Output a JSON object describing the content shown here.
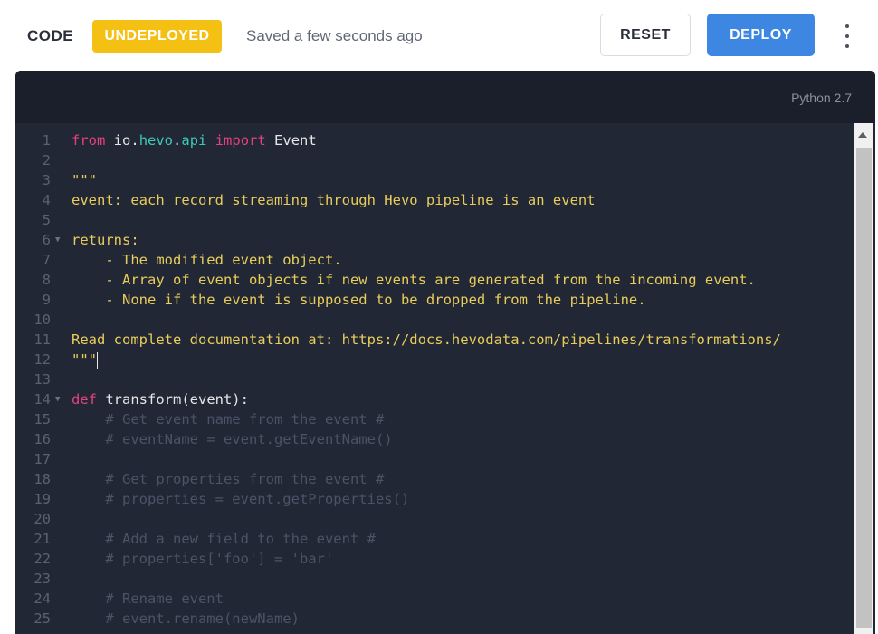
{
  "header": {
    "title": "CODE",
    "status_badge": "UNDEPLOYED",
    "saved_text": "Saved a few seconds ago",
    "reset_label": "RESET",
    "deploy_label": "DEPLOY",
    "more_icon": "kebab-menu-icon"
  },
  "editor": {
    "language": "Python 2.7",
    "lines": [
      {
        "n": "1"
      },
      {
        "n": "2"
      },
      {
        "n": "3"
      },
      {
        "n": "4"
      },
      {
        "n": "5"
      },
      {
        "n": "6"
      },
      {
        "n": "7"
      },
      {
        "n": "8"
      },
      {
        "n": "9"
      },
      {
        "n": "10"
      },
      {
        "n": "11"
      },
      {
        "n": "12"
      },
      {
        "n": "13"
      },
      {
        "n": "14"
      },
      {
        "n": "15"
      },
      {
        "n": "16"
      },
      {
        "n": "17"
      },
      {
        "n": "18"
      },
      {
        "n": "19"
      },
      {
        "n": "20"
      },
      {
        "n": "21"
      },
      {
        "n": "22"
      },
      {
        "n": "23"
      },
      {
        "n": "24"
      },
      {
        "n": "25"
      }
    ],
    "code": {
      "l1_from": "from",
      "l1_mod1": "io",
      "l1_dot1": ".",
      "l1_mod2": "hevo",
      "l1_dot2": ".",
      "l1_mod3": "api",
      "l1_import": "import",
      "l1_event": "Event",
      "l3": "\"\"\"",
      "l4": "event: each record streaming through Hevo pipeline is an event",
      "l6": "returns:",
      "l7": "    - The modified event object.",
      "l8": "    - Array of event objects if new events are generated from the incoming event.",
      "l9": "    - None if the event is supposed to be dropped from the pipeline.",
      "l11": "Read complete documentation at: https://docs.hevodata.com/pipelines/transformations/",
      "l12": "\"\"\"",
      "l14_def": "def",
      "l14_rest": " transform(event):",
      "l15": "    # Get event name from the event #",
      "l16": "    # eventName = event.getEventName()",
      "l18": "    # Get properties from the event #",
      "l19": "    # properties = event.getProperties()",
      "l21": "    # Add a new field to the event #",
      "l22": "    # properties['foo'] = 'bar'",
      "l24": "    # Rename event",
      "l25": "    # event.rename(newName)"
    }
  }
}
